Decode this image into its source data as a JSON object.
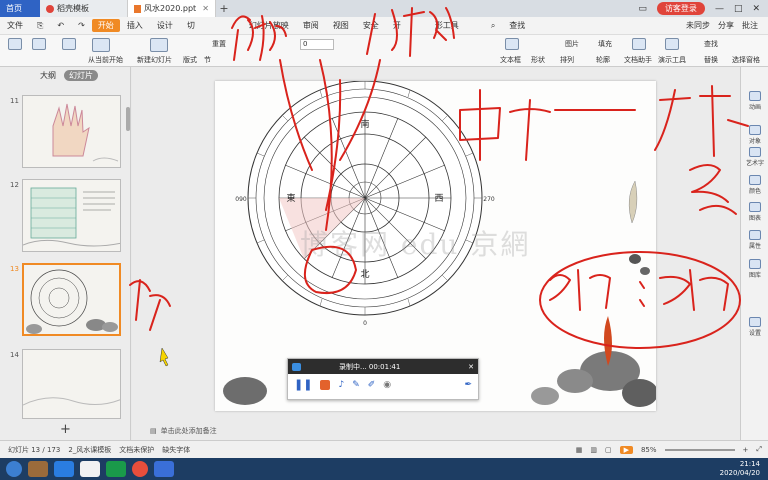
{
  "tabs": {
    "home": "首页",
    "template": "稻壳模板",
    "document": "风水2020.ppt",
    "add": "+"
  },
  "window": {
    "login_button": "访客登录"
  },
  "menu": {
    "file": "文件",
    "start": "开始",
    "insert": "插入",
    "design": "设计",
    "switch": "切",
    "slideshow": "幻灯片放映",
    "review": "审阅",
    "view": "视图",
    "security": "安全",
    "developer": "开",
    "format_tools": "形工具",
    "search": "查找",
    "unsynced": "未同步",
    "share": "分享",
    "comment": "批注"
  },
  "ribbon": {
    "from_current": "从当前开始",
    "new_slide": "新建幻灯片",
    "layout": "版式",
    "section": "节",
    "reset": "重置",
    "font_size": "0",
    "textbox": "文本框",
    "shape": "形状",
    "arrange": "排列",
    "image": "图片",
    "fill": "填充",
    "outline": "轮廓",
    "doc_assistant": "文档助手",
    "presentation_tools": "演示工具",
    "find": "查找",
    "replace": "替换",
    "select_pane": "选择窗格"
  },
  "left_pane": {
    "outline_tab": "大纲",
    "slides_tab": "幻灯片",
    "thumbnails": [
      {
        "number": "11"
      },
      {
        "number": "12"
      },
      {
        "number": "13"
      },
      {
        "number": "14"
      }
    ],
    "add_button": "+"
  },
  "notes_placeholder": "单击此处添加备注",
  "right_bar": {
    "animation": "动画",
    "object": "对象",
    "art_text": "艺术字",
    "color": "颜色",
    "chart": "图表",
    "property": "属性",
    "gallery": "图库",
    "settings": "设置"
  },
  "compass": {
    "degrees_top": "180",
    "degrees_bottom": "0",
    "degrees_left": "090",
    "degrees_right": "270",
    "directions": {
      "south": "南",
      "north": "北",
      "east": "東",
      "west": "西"
    }
  },
  "watermark": "博客网 edu 京網",
  "recorder": {
    "title": "录制中... 00:01:41",
    "close": "✕"
  },
  "status": {
    "slide_position": "幻灯片 13 / 173",
    "template_name": "2_风水课模板",
    "protection": "文档未保护",
    "missing_font": "缺失字体",
    "zoom": "85%"
  },
  "clock": {
    "time": "21:14",
    "date": "2020/04/20"
  },
  "colors": {
    "accent": "#f08a24",
    "ink": "#d9231c",
    "home_tab": "#2f63c4",
    "taskbar": "#1d3d63"
  },
  "annotations": {
    "top_left": "午兔",
    "top_center": "/ 方向",
    "top_right": "甲子辰一 已酉丑",
    "right_mid": "三合",
    "bottom_right": "水法 伯煞",
    "left_side": "三合 禄"
  }
}
